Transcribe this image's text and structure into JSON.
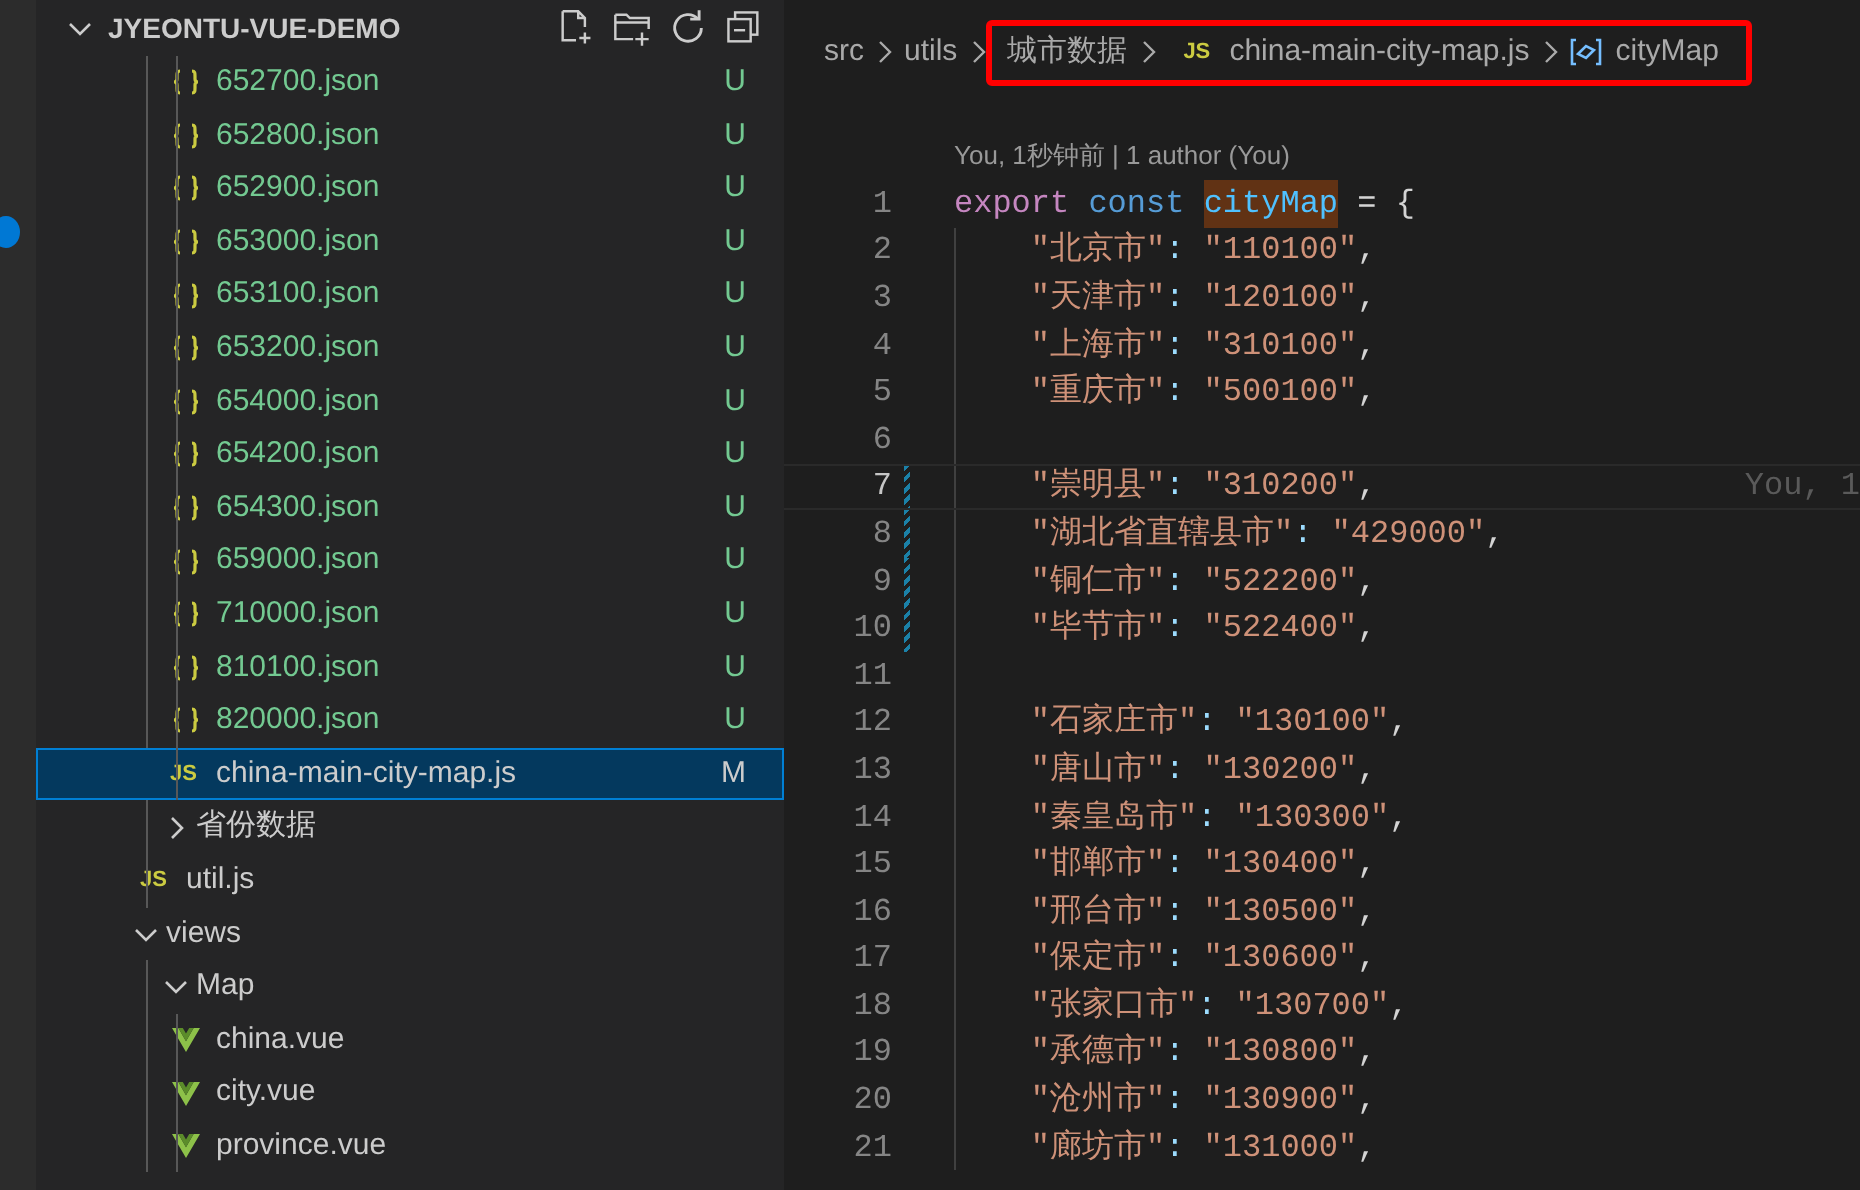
{
  "explorer": {
    "title": "JYEONTU-VUE-DEMO",
    "expanded": true,
    "tree": [
      {
        "children": [
          {
            "children": [
              {
                "label": "652700.json",
                "kind": "json",
                "status": "U",
                "color": "#73c991",
                "selected": false
              },
              {
                "label": "652800.json",
                "kind": "json",
                "status": "U",
                "color": "#73c991",
                "selected": false
              },
              {
                "label": "652900.json",
                "kind": "json",
                "status": "U",
                "color": "#73c991",
                "selected": false
              },
              {
                "label": "653000.json",
                "kind": "json",
                "status": "U",
                "color": "#73c991",
                "selected": false
              },
              {
                "label": "653100.json",
                "kind": "json",
                "status": "U",
                "color": "#73c991",
                "selected": false
              },
              {
                "label": "653200.json",
                "kind": "json",
                "status": "U",
                "color": "#73c991",
                "selected": false
              },
              {
                "label": "654000.json",
                "kind": "json",
                "status": "U",
                "color": "#73c991",
                "selected": false
              },
              {
                "label": "654200.json",
                "kind": "json",
                "status": "U",
                "color": "#73c991",
                "selected": false
              },
              {
                "label": "654300.json",
                "kind": "json",
                "status": "U",
                "color": "#73c991",
                "selected": false
              },
              {
                "label": "659000.json",
                "kind": "json",
                "status": "U",
                "color": "#73c991",
                "selected": false
              },
              {
                "label": "710000.json",
                "kind": "json",
                "status": "U",
                "color": "#73c991",
                "selected": false
              },
              {
                "label": "810100.json",
                "kind": "json",
                "status": "U",
                "color": "#73c991",
                "selected": false
              },
              {
                "label": "820000.json",
                "kind": "json",
                "status": "U",
                "color": "#73c991",
                "selected": false
              },
              {
                "label": "china-main-city-map.js",
                "kind": "js",
                "icon_text": "JS",
                "status": "M",
                "selected": true
              }
            ]
          },
          {
            "label": "省份数据",
            "kind": "folder",
            "expanded": false,
            "selected": false
          },
          {
            "label": "util.js",
            "kind": "js",
            "icon_text": "JS",
            "selected": false
          }
        ]
      },
      {
        "label": "views",
        "kind": "folder",
        "expanded": true,
        "selected": false,
        "children": [
          {
            "label": "Map",
            "kind": "folder",
            "expanded": true,
            "selected": false,
            "children": [
              {
                "label": "china.vue",
                "kind": "vue",
                "selected": false
              },
              {
                "label": "city.vue",
                "kind": "vue",
                "selected": false
              },
              {
                "label": "province.vue",
                "kind": "vue",
                "selected": false
              }
            ]
          }
        ]
      }
    ]
  },
  "breadcrumb": [
    {
      "label": "src",
      "kind": "folder",
      "boxed": false
    },
    {
      "label": "utils",
      "kind": "folder",
      "boxed": false
    },
    {
      "label": "城市数据",
      "kind": "folder",
      "boxed": true
    },
    {
      "label": "china-main-city-map.js",
      "kind": "js",
      "icon_text": "JS",
      "boxed": true
    },
    {
      "label": "cityMap",
      "kind": "symbol",
      "boxed": true
    }
  ],
  "codelens": "You, 1秒钟前 | 1 author (You)",
  "lines": [
    {
      "number": "1",
      "indented": false,
      "current": false,
      "modified": false,
      "tokens": [
        {
          "text": "export",
          "kind": "keyword"
        },
        {
          "text": "const",
          "kind": "storage",
          "space": true
        },
        {
          "text": "cityMap",
          "kind": "variable",
          "space": true
        },
        {
          "text": "= {",
          "kind": "punct",
          "space": true
        }
      ]
    },
    {
      "number": "2",
      "indented": true,
      "current": false,
      "modified": false,
      "tokens": [
        {
          "text": "\"北京市\"",
          "kind": "string"
        },
        {
          "text": ":",
          "kind": "colon"
        },
        {
          "text": "\"110100\"",
          "kind": "string",
          "space": true
        },
        {
          "text": ",",
          "kind": "punct"
        }
      ]
    },
    {
      "number": "3",
      "indented": true,
      "current": false,
      "modified": false,
      "tokens": [
        {
          "text": "\"天津市\"",
          "kind": "string"
        },
        {
          "text": ":",
          "kind": "colon"
        },
        {
          "text": "\"120100\"",
          "kind": "string",
          "space": true
        },
        {
          "text": ",",
          "kind": "punct"
        }
      ]
    },
    {
      "number": "4",
      "indented": true,
      "current": false,
      "modified": false,
      "tokens": [
        {
          "text": "\"上海市\"",
          "kind": "string"
        },
        {
          "text": ":",
          "kind": "colon"
        },
        {
          "text": "\"310100\"",
          "kind": "string",
          "space": true
        },
        {
          "text": ",",
          "kind": "punct"
        }
      ]
    },
    {
      "number": "5",
      "indented": true,
      "current": false,
      "modified": false,
      "tokens": [
        {
          "text": "\"重庆市\"",
          "kind": "string"
        },
        {
          "text": ":",
          "kind": "colon"
        },
        {
          "text": "\"500100\"",
          "kind": "string",
          "space": true
        },
        {
          "text": ",",
          "kind": "punct"
        }
      ]
    },
    {
      "number": "6",
      "indented": true,
      "current": false,
      "modified": false
    },
    {
      "number": "7",
      "indented": true,
      "current": true,
      "modified": true,
      "blame": "You, 1",
      "tokens": [
        {
          "text": "\"崇明县\"",
          "kind": "string"
        },
        {
          "text": ":",
          "kind": "colon"
        },
        {
          "text": "\"310200\"",
          "kind": "string",
          "space": true
        },
        {
          "text": ",",
          "kind": "punct"
        }
      ]
    },
    {
      "number": "8",
      "indented": true,
      "current": false,
      "modified": true,
      "tokens": [
        {
          "text": "\"湖北省直辖县市\"",
          "kind": "string"
        },
        {
          "text": ":",
          "kind": "colon"
        },
        {
          "text": "\"429000\"",
          "kind": "string",
          "space": true
        },
        {
          "text": ",",
          "kind": "punct"
        }
      ]
    },
    {
      "number": "9",
      "indented": true,
      "current": false,
      "modified": true,
      "tokens": [
        {
          "text": "\"铜仁市\"",
          "kind": "string"
        },
        {
          "text": ":",
          "kind": "colon"
        },
        {
          "text": "\"522200\"",
          "kind": "string",
          "space": true
        },
        {
          "text": ",",
          "kind": "punct"
        }
      ]
    },
    {
      "number": "10",
      "indented": true,
      "current": false,
      "modified": true,
      "tokens": [
        {
          "text": "\"毕节市\"",
          "kind": "string"
        },
        {
          "text": ":",
          "kind": "colon"
        },
        {
          "text": "\"522400\"",
          "kind": "string",
          "space": true
        },
        {
          "text": ",",
          "kind": "punct"
        }
      ]
    },
    {
      "number": "11",
      "indented": true,
      "current": false,
      "modified": false
    },
    {
      "number": "12",
      "indented": true,
      "current": false,
      "modified": false,
      "tokens": [
        {
          "text": "\"石家庄市\"",
          "kind": "string"
        },
        {
          "text": ":",
          "kind": "colon"
        },
        {
          "text": "\"130100\"",
          "kind": "string",
          "space": true
        },
        {
          "text": ",",
          "kind": "punct"
        }
      ]
    },
    {
      "number": "13",
      "indented": true,
      "current": false,
      "modified": false,
      "tokens": [
        {
          "text": "\"唐山市\"",
          "kind": "string"
        },
        {
          "text": ":",
          "kind": "colon"
        },
        {
          "text": "\"130200\"",
          "kind": "string",
          "space": true
        },
        {
          "text": ",",
          "kind": "punct"
        }
      ]
    },
    {
      "number": "14",
      "indented": true,
      "current": false,
      "modified": false,
      "tokens": [
        {
          "text": "\"秦皇岛市\"",
          "kind": "string"
        },
        {
          "text": ":",
          "kind": "colon"
        },
        {
          "text": "\"130300\"",
          "kind": "string",
          "space": true
        },
        {
          "text": ",",
          "kind": "punct"
        }
      ]
    },
    {
      "number": "15",
      "indented": true,
      "current": false,
      "modified": false,
      "tokens": [
        {
          "text": "\"邯郸市\"",
          "kind": "string"
        },
        {
          "text": ":",
          "kind": "colon"
        },
        {
          "text": "\"130400\"",
          "kind": "string",
          "space": true
        },
        {
          "text": ",",
          "kind": "punct"
        }
      ]
    },
    {
      "number": "16",
      "indented": true,
      "current": false,
      "modified": false,
      "tokens": [
        {
          "text": "\"邢台市\"",
          "kind": "string"
        },
        {
          "text": ":",
          "kind": "colon"
        },
        {
          "text": "\"130500\"",
          "kind": "string",
          "space": true
        },
        {
          "text": ",",
          "kind": "punct"
        }
      ]
    },
    {
      "number": "17",
      "indented": true,
      "current": false,
      "modified": false,
      "tokens": [
        {
          "text": "\"保定市\"",
          "kind": "string"
        },
        {
          "text": ":",
          "kind": "colon"
        },
        {
          "text": "\"130600\"",
          "kind": "string",
          "space": true
        },
        {
          "text": ",",
          "kind": "punct"
        }
      ]
    },
    {
      "number": "18",
      "indented": true,
      "current": false,
      "modified": false,
      "tokens": [
        {
          "text": "\"张家口市\"",
          "kind": "string"
        },
        {
          "text": ":",
          "kind": "colon"
        },
        {
          "text": "\"130700\"",
          "kind": "string",
          "space": true
        },
        {
          "text": ",",
          "kind": "punct"
        }
      ]
    },
    {
      "number": "19",
      "indented": true,
      "current": false,
      "modified": false,
      "tokens": [
        {
          "text": "\"承德市\"",
          "kind": "string"
        },
        {
          "text": ":",
          "kind": "colon"
        },
        {
          "text": "\"130800\"",
          "kind": "string",
          "space": true
        },
        {
          "text": ",",
          "kind": "punct"
        }
      ]
    },
    {
      "number": "20",
      "indented": true,
      "current": false,
      "modified": false,
      "tokens": [
        {
          "text": "\"沧州市\"",
          "kind": "string"
        },
        {
          "text": ":",
          "kind": "colon"
        },
        {
          "text": "\"130900\"",
          "kind": "string",
          "space": true
        },
        {
          "text": ",",
          "kind": "punct"
        }
      ]
    },
    {
      "number": "21",
      "indented": true,
      "current": false,
      "modified": false,
      "tokens": [
        {
          "text": "\"廊坊市\"",
          "kind": "string"
        },
        {
          "text": ":",
          "kind": "colon"
        },
        {
          "text": "\"131000\"",
          "kind": "string",
          "space": true
        },
        {
          "text": ",",
          "kind": "punct"
        }
      ]
    }
  ]
}
